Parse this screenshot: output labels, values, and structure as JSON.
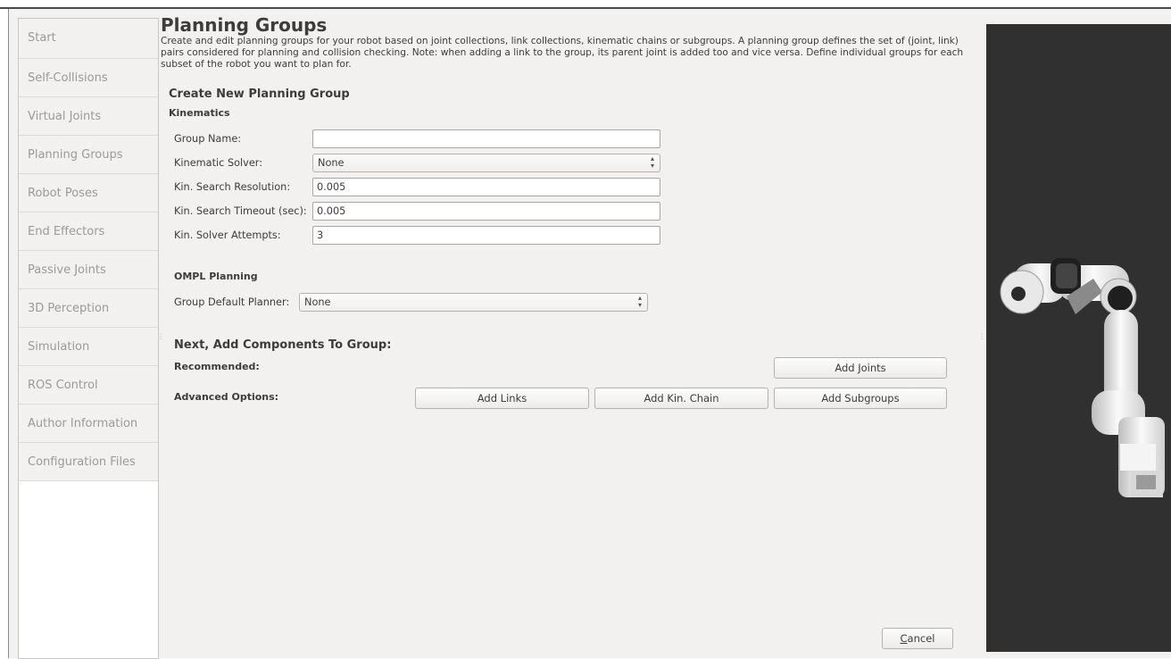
{
  "sidebar": {
    "items": [
      {
        "label": "Start"
      },
      {
        "label": "Self-Collisions"
      },
      {
        "label": "Virtual Joints"
      },
      {
        "label": "Planning Groups"
      },
      {
        "label": "Robot Poses"
      },
      {
        "label": "End Effectors"
      },
      {
        "label": "Passive Joints"
      },
      {
        "label": "3D Perception"
      },
      {
        "label": "Simulation"
      },
      {
        "label": "ROS Control"
      },
      {
        "label": "Author Information"
      },
      {
        "label": "Configuration Files"
      }
    ]
  },
  "page": {
    "title": "Planning Groups",
    "description": "Create and edit planning groups for your robot based on joint collections, link collections, kinematic chains or subgroups. A planning group defines the set of (joint, link) pairs considered for planning and collision checking. Note: when adding a link to the group, its parent joint is added too and vice versa. Define individual groups for each subset of the robot you want to plan for."
  },
  "create": {
    "heading": "Create New Planning Group",
    "kinematics_label": "Kinematics",
    "group_name_label": "Group Name:",
    "group_name_value": "",
    "solver_label": "Kinematic Solver:",
    "solver_value": "None",
    "resolution_label": "Kin. Search Resolution:",
    "resolution_value": "0.005",
    "timeout_label": "Kin. Search Timeout (sec):",
    "timeout_value": "0.005",
    "attempts_label": "Kin. Solver Attempts:",
    "attempts_value": "3",
    "ompl_label": "OMPL Planning",
    "planner_label": "Group Default Planner:",
    "planner_value": "None"
  },
  "components": {
    "heading": "Next, Add Components To Group:",
    "recommended_label": "Recommended:",
    "advanced_label": "Advanced Options:",
    "add_joints": "Add Joints",
    "add_links": "Add Links",
    "add_chain": "Add Kin. Chain",
    "add_subgroups": "Add Subgroups"
  },
  "footer": {
    "cancel_prefix": "C",
    "cancel_rest": "ancel"
  },
  "colors": {
    "viewport_bg": "#303030",
    "window_bg": "#f2f1f0",
    "robot": "#eeeeee"
  }
}
